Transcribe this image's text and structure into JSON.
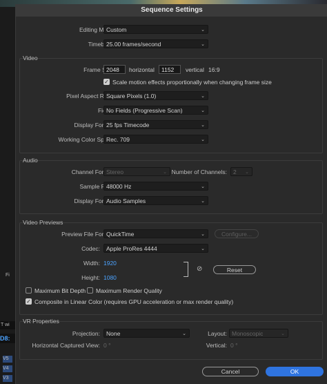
{
  "window_title": "Sequence Settings",
  "background_panel": {
    "tab_label": "T wi",
    "timecode": "D8:",
    "label_fi": "Fi",
    "label_v5": "V5",
    "label_v4": "V4",
    "label_v3": "V3"
  },
  "general": {
    "editing_mode_label": "Editing Mode:",
    "editing_mode_value": "Custom",
    "timebase_label": "Timebase:",
    "timebase_value": "25.00  frames/second"
  },
  "video": {
    "section_title": "Video",
    "frame_size_label": "Frame Size:",
    "frame_width": "2048",
    "horizontal_label": "horizontal",
    "frame_height": "1152",
    "vertical_label": "vertical",
    "aspect_ratio": "16:9",
    "scale_motion_label": "Scale motion effects proportionally when changing frame size",
    "scale_motion_checked": true,
    "pixel_aspect_label": "Pixel Aspect Ratio:",
    "pixel_aspect_value": "Square Pixels (1.0)",
    "fields_label": "Fields:",
    "fields_value": "No Fields (Progressive Scan)",
    "display_format_label": "Display Format:",
    "display_format_value": "25 fps Timecode",
    "color_space_label": "Working Color Space:",
    "color_space_value": "Rec. 709"
  },
  "audio": {
    "section_title": "Audio",
    "channel_format_label": "Channel Format:",
    "channel_format_value": "Stereo",
    "num_channels_label": "Number of Channels:",
    "num_channels_value": "2",
    "sample_rate_label": "Sample Rate:",
    "sample_rate_value": "48000 Hz",
    "display_format_label": "Display Format:",
    "display_format_value": "Audio Samples"
  },
  "previews": {
    "section_title": "Video Previews",
    "file_format_label": "Preview File Format:",
    "file_format_value": "QuickTime",
    "configure_label": "Configure...",
    "codec_label": "Codec:",
    "codec_value": "Apple ProRes 4444",
    "width_label": "Width:",
    "width_value": "1920",
    "height_label": "Height:",
    "height_value": "1080",
    "reset_label": "Reset",
    "max_bit_depth_label": "Maximum Bit Depth",
    "max_bit_depth_checked": false,
    "max_render_quality_label": "Maximum Render Quality",
    "max_render_quality_checked": false,
    "linear_color_label": "Composite in Linear Color (requires GPU acceleration or max render quality)",
    "linear_color_checked": true
  },
  "vr": {
    "section_title": "VR Properties",
    "projection_label": "Projection:",
    "projection_value": "None",
    "layout_label": "Layout:",
    "layout_value": "Monoscopic",
    "h_view_label": "Horizontal Captured View:",
    "h_view_value": "0 °",
    "vertical_label": "Vertical:",
    "vertical_value": "0 °"
  },
  "buttons": {
    "cancel": "Cancel",
    "ok": "OK"
  },
  "colors": {
    "accent": "#2f74e0",
    "link_value": "#4ca3ff"
  }
}
